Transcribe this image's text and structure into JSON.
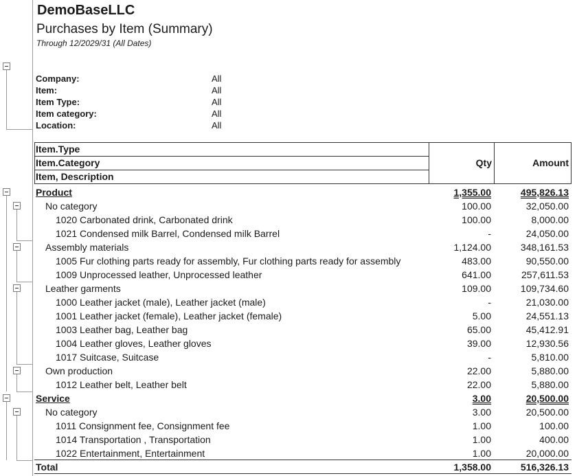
{
  "header": {
    "company": "DemoBaseLLC",
    "title": "Purchases by Item (Summary)",
    "period": "Through 12/2029/31 (All Dates)"
  },
  "filters": [
    {
      "label": "Company:",
      "value": "All"
    },
    {
      "label": "Item:",
      "value": "All"
    },
    {
      "label": "Item Type:",
      "value": "All"
    },
    {
      "label": "Item category:",
      "value": "All"
    },
    {
      "label": "Location:",
      "value": "All"
    }
  ],
  "table_header": {
    "group1": "Item.Type",
    "group2": "Item.Category",
    "group3": "Item, Description",
    "qty": "Qty",
    "amount": "Amount"
  },
  "rows": [
    {
      "level": 0,
      "desc": "Product",
      "qty": "1,355.00",
      "amount": "495,826.13"
    },
    {
      "level": 1,
      "desc": "No category",
      "qty": "100.00",
      "amount": "32,050.00"
    },
    {
      "level": 2,
      "desc": "1020 Carbonated drink, Carbonated drink",
      "qty": "100.00",
      "amount": "8,000.00"
    },
    {
      "level": 2,
      "desc": "1021 Condensed milk Barrel, Condensed milk Barrel",
      "qty": "-",
      "amount": "24,050.00"
    },
    {
      "level": 1,
      "desc": "Assembly materials",
      "qty": "1,124.00",
      "amount": "348,161.53"
    },
    {
      "level": 2,
      "desc": "1005 Fur clothing parts ready for assembly, Fur clothing parts ready for assembly",
      "qty": "483.00",
      "amount": "90,550.00"
    },
    {
      "level": 2,
      "desc": "1009 Unprocessed leather, Unprocessed leather",
      "qty": "641.00",
      "amount": "257,611.53"
    },
    {
      "level": 1,
      "desc": "Leather garments",
      "qty": "109.00",
      "amount": "109,734.60"
    },
    {
      "level": 2,
      "desc": "1000 Leather jacket (male), Leather jacket (male)",
      "qty": "-",
      "amount": "21,030.00"
    },
    {
      "level": 2,
      "desc": "1001 Leather jacket (female), Leather jacket (female)",
      "qty": "5.00",
      "amount": "24,551.13"
    },
    {
      "level": 2,
      "desc": "1003 Leather bag, Leather bag",
      "qty": "65.00",
      "amount": "45,412.91"
    },
    {
      "level": 2,
      "desc": "1004 Leather gloves, Leather gloves",
      "qty": "39.00",
      "amount": "12,930.56"
    },
    {
      "level": 2,
      "desc": "1017 Suitcase, Suitcase",
      "qty": "-",
      "amount": "5,810.00"
    },
    {
      "level": 1,
      "desc": "Own production",
      "qty": "22.00",
      "amount": "5,880.00"
    },
    {
      "level": 2,
      "desc": "1012 Leather belt, Leather belt",
      "qty": "22.00",
      "amount": "5,880.00"
    },
    {
      "level": 0,
      "desc": "Service",
      "qty": "3.00",
      "amount": "20,500.00"
    },
    {
      "level": 1,
      "desc": "No category",
      "qty": "3.00",
      "amount": "20,500.00"
    },
    {
      "level": 2,
      "desc": "1011 Consignment fee, Consignment fee",
      "qty": "1.00",
      "amount": "100.00"
    },
    {
      "level": 2,
      "desc": "1014 Transportation , Transportation",
      "qty": "1.00",
      "amount": "400.00"
    },
    {
      "level": 2,
      "desc": "1022 Entertainment, Entertainment",
      "qty": "1.00",
      "amount": "20,000.00"
    }
  ],
  "total": {
    "label": "Total",
    "qty": "1,358.00",
    "amount": "516,326.13"
  }
}
